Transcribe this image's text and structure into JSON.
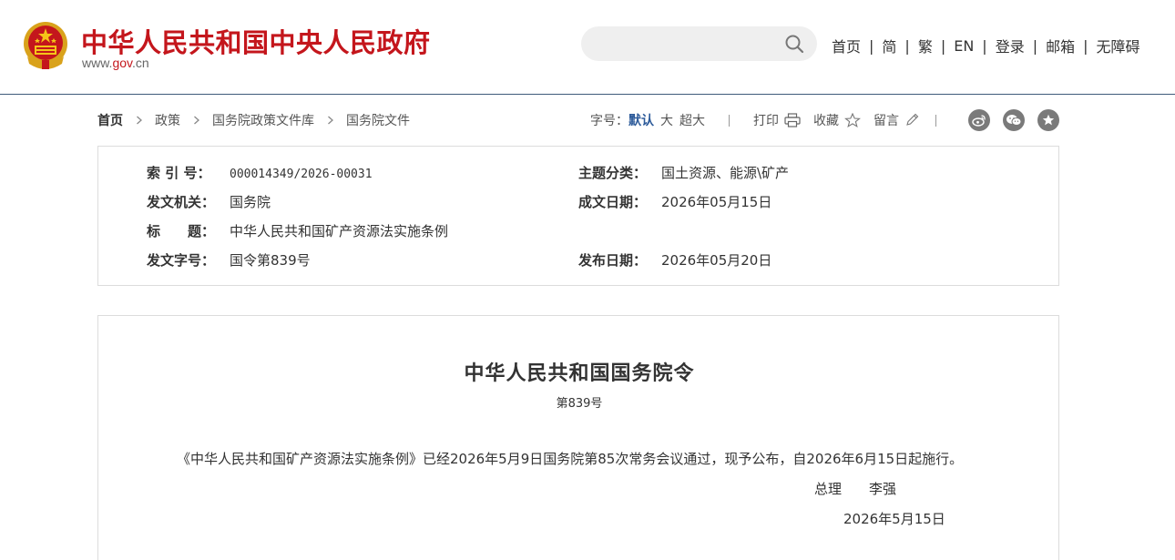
{
  "header": {
    "site_title": "中华人民共和国中央人民政府",
    "url_prefix": "www.",
    "url_gov": "gov",
    "url_suffix": ".cn",
    "search_placeholder": "",
    "nav": [
      "首页",
      "简",
      "繁",
      "EN",
      "登录",
      "邮箱",
      "无障碍"
    ],
    "nav_separator": "|"
  },
  "breadcrumb": [
    "首页",
    "政策",
    "国务院政策文件库",
    "国务院文件"
  ],
  "toolbar": {
    "font_size_label": "字号：",
    "font_default": "默认",
    "font_large": "大",
    "font_xlarge": "超大",
    "print_label": "打印",
    "favorite_label": "收藏",
    "comment_label": "留言"
  },
  "share_icons": [
    "weibo-icon",
    "wechat-icon",
    "star-circle-icon"
  ],
  "info": {
    "index_key": "索 引 号：",
    "index_val": "000014349/2026-00031",
    "topic_key": "主题分类：",
    "topic_val": "国土资源、能源\\矿产",
    "issuer_key": "发文机关：",
    "issuer_val": "国务院",
    "written_key": "成文日期：",
    "written_val": "2026年05月15日",
    "title_key": "标　　题：",
    "title_val": "中华人民共和国矿产资源法实施条例",
    "docno_key": "发文字号：",
    "docno_val": "国令第839号",
    "published_key": "发布日期：",
    "published_val": "2026年05月20日"
  },
  "doc": {
    "title": "中华人民共和国国务院令",
    "number": "第839号",
    "body": "《中华人民共和国矿产资源法实施条例》已经2026年5月9日国务院第85次常务会议通过，现予公布，自2026年6月15日起施行。",
    "sign_role": "总理",
    "sign_name": "李强",
    "date": "2026年5月15日"
  },
  "colors": {
    "brand_red": "#c4161c",
    "accent_blue": "#2d5b9a",
    "header_rule": "#3e5a7a",
    "border": "#dcdcdc"
  }
}
